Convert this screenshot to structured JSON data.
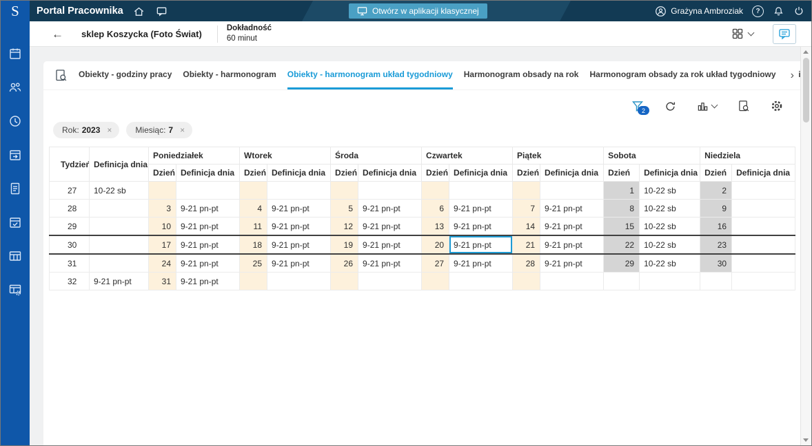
{
  "topbar": {
    "logo": "S",
    "title": "Portal Pracownika",
    "open_classic": "Otwórz w aplikacji klasycznej",
    "user": "Grażyna Ambroziak"
  },
  "subheader": {
    "title": "sklep Koszycka (Foto Świat)",
    "accuracy_label": "Dokładność",
    "accuracy_value": "60 minut"
  },
  "glyphs": {
    "back": "←",
    "close": "×",
    "more": "›",
    "help": "?"
  },
  "tabs": [
    {
      "label": "Obiekty - godziny pracy",
      "active": false
    },
    {
      "label": "Obiekty - harmonogram",
      "active": false
    },
    {
      "label": "Obiekty - harmonogram układ tygodniowy",
      "active": true
    },
    {
      "label": "Harmonogram obsady na rok",
      "active": false
    },
    {
      "label": "Harmonogram obsady za rok układ tygodniowy",
      "active": false
    },
    {
      "label": "Obiekty",
      "active": false
    }
  ],
  "toolbar": {
    "filter_badge": "2"
  },
  "filters": [
    {
      "label": "Rok:",
      "value": "2023"
    },
    {
      "label": "Miesiąc:",
      "value": "7"
    }
  ],
  "table": {
    "col_week": "Tydzień",
    "col_day": "Dzień",
    "col_day_def": "Definicja dnia",
    "days": [
      "Poniedziałek",
      "Wtorek",
      "Środa",
      "Czwartek",
      "Piątek",
      "Sobota",
      "Niedziela"
    ],
    "rows": [
      {
        "week": "27",
        "week_def": "10-22 sb",
        "selected": false,
        "cells": [
          {
            "d": "",
            "t": "",
            "f": "b"
          },
          {
            "d": "",
            "t": "",
            "f": "b"
          },
          {
            "d": "",
            "t": "",
            "f": "b"
          },
          {
            "d": "",
            "t": "",
            "f": "b"
          },
          {
            "d": "",
            "t": "",
            "f": "b"
          },
          {
            "d": "1",
            "t": "10-22 sb",
            "f": "g"
          },
          {
            "d": "2",
            "t": "",
            "f": "g"
          }
        ]
      },
      {
        "week": "28",
        "week_def": "",
        "selected": false,
        "cells": [
          {
            "d": "3",
            "t": "9-21 pn-pt",
            "f": "b"
          },
          {
            "d": "4",
            "t": "9-21 pn-pt",
            "f": "b"
          },
          {
            "d": "5",
            "t": "9-21 pn-pt",
            "f": "b"
          },
          {
            "d": "6",
            "t": "9-21 pn-pt",
            "f": "b"
          },
          {
            "d": "7",
            "t": "9-21 pn-pt",
            "f": "b"
          },
          {
            "d": "8",
            "t": "10-22 sb",
            "f": "g"
          },
          {
            "d": "9",
            "t": "",
            "f": "g"
          }
        ]
      },
      {
        "week": "29",
        "week_def": "",
        "selected": false,
        "cells": [
          {
            "d": "10",
            "t": "9-21 pn-pt",
            "f": "b"
          },
          {
            "d": "11",
            "t": "9-21 pn-pt",
            "f": "b"
          },
          {
            "d": "12",
            "t": "9-21 pn-pt",
            "f": "b"
          },
          {
            "d": "13",
            "t": "9-21 pn-pt",
            "f": "b"
          },
          {
            "d": "14",
            "t": "9-21 pn-pt",
            "f": "b"
          },
          {
            "d": "15",
            "t": "10-22 sb",
            "f": "g"
          },
          {
            "d": "16",
            "t": "",
            "f": "g"
          }
        ]
      },
      {
        "week": "30",
        "week_def": "",
        "selected": true,
        "cells": [
          {
            "d": "17",
            "t": "9-21 pn-pt",
            "f": "b"
          },
          {
            "d": "18",
            "t": "9-21 pn-pt",
            "f": "b"
          },
          {
            "d": "19",
            "t": "9-21 pn-pt",
            "f": "b"
          },
          {
            "d": "20",
            "t": "9-21 pn-pt",
            "f": "b",
            "sel": true
          },
          {
            "d": "21",
            "t": "9-21 pn-pt",
            "f": "b"
          },
          {
            "d": "22",
            "t": "10-22 sb",
            "f": "g"
          },
          {
            "d": "23",
            "t": "",
            "f": "g"
          }
        ]
      },
      {
        "week": "31",
        "week_def": "",
        "selected": false,
        "cells": [
          {
            "d": "24",
            "t": "9-21 pn-pt",
            "f": "b"
          },
          {
            "d": "25",
            "t": "9-21 pn-pt",
            "f": "b"
          },
          {
            "d": "26",
            "t": "9-21 pn-pt",
            "f": "b"
          },
          {
            "d": "27",
            "t": "9-21 pn-pt",
            "f": "b"
          },
          {
            "d": "28",
            "t": "9-21 pn-pt",
            "f": "b"
          },
          {
            "d": "29",
            "t": "10-22 sb",
            "f": "g"
          },
          {
            "d": "30",
            "t": "",
            "f": "g"
          }
        ]
      },
      {
        "week": "32",
        "week_def": "9-21 pn-pt",
        "selected": false,
        "cells": [
          {
            "d": "31",
            "t": "9-21 pn-pt",
            "f": "b"
          },
          {
            "d": "",
            "t": "",
            "f": "b"
          },
          {
            "d": "",
            "t": "",
            "f": "b"
          },
          {
            "d": "",
            "t": "",
            "f": "b"
          },
          {
            "d": "",
            "t": "",
            "f": "b"
          },
          {
            "d": "",
            "t": "",
            "f": "n"
          },
          {
            "d": "",
            "t": "",
            "f": "n"
          }
        ]
      }
    ]
  }
}
